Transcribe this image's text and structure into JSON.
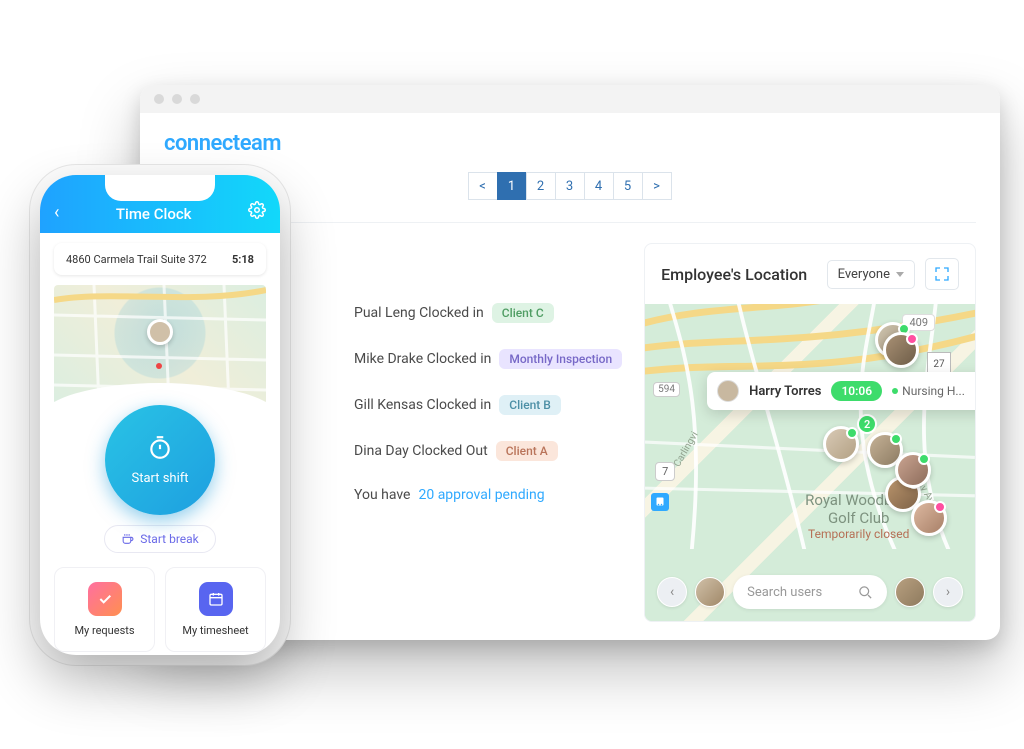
{
  "logo": "connecteam",
  "pagination": {
    "prev": "<",
    "p1": "1",
    "p2": "2",
    "p3": "3",
    "p4": "4",
    "p5": "5",
    "next": ">"
  },
  "feed": {
    "i1_name": "Pual Leng Clocked in",
    "i1_badge": "Client C",
    "i2_name": "Mike Drake Clocked in",
    "i2_badge": "Monthly Inspection",
    "i3_name": "Gill Kensas Clocked in",
    "i3_badge": "Client B",
    "i4_name": "Dina Day Clocked Out",
    "i4_badge": "Client A",
    "i5_prefix": "You have ",
    "i5_link": "20 approval pending"
  },
  "mapPanel": {
    "title": "Employee's Location",
    "dropdown": "Everyone",
    "badge409": "409",
    "badge27": "27",
    "badge7": "7",
    "badge594": "594",
    "cluster": "2",
    "roadCarlingvi": "Carlingvi",
    "roadSkyway": "Skyway Ave",
    "poi": "Royal Woodbine\nGolf Club",
    "poi_sub": "Temporarily closed",
    "callout": {
      "name": "Harry Torres",
      "time": "10:06",
      "location": "Nursing H..."
    },
    "search_placeholder": "Search users"
  },
  "phone": {
    "header_title": "Time Clock",
    "address": "4860 Carmela Trail Suite 372",
    "time": "5:18",
    "start_shift": "Start shift",
    "start_break": "Start break",
    "tile1": "My requests",
    "tile2": "My timesheet"
  }
}
